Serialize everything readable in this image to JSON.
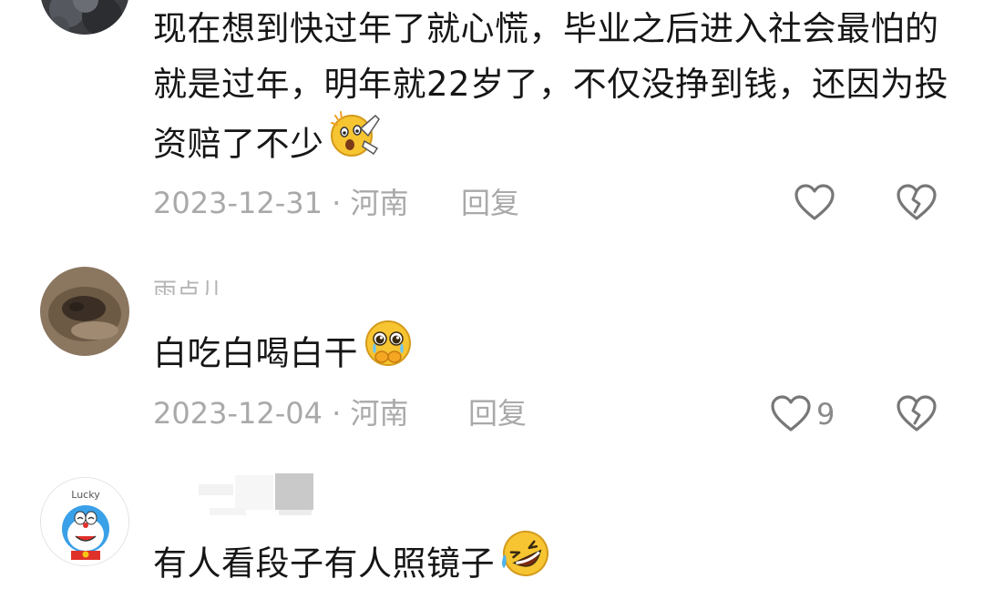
{
  "comments": [
    {
      "text": "现在想到快过年了就心慌，毕业之后进入社会最怕的就是过年，明年就22岁了，不仅没挣到钱，还因为投资赔了不少",
      "emoji": "shocked-face-icon",
      "date": "2023-12-31",
      "location": "河南",
      "reply_label": "回复",
      "likes": ""
    },
    {
      "username": "雨点儿",
      "text": "白吃白喝白干",
      "emoji": "crying-pleading-face-icon",
      "date": "2023-12-04",
      "location": "河南",
      "reply_label": "回复",
      "likes": "9"
    },
    {
      "avatar_text": "Lucky",
      "text": "有人看段子有人照镜子",
      "emoji": "rofl-face-icon"
    }
  ],
  "separator": " · ",
  "colors": {
    "text": "#161616",
    "meta": "#a9a9a9",
    "username": "#b4b4b4",
    "icon": "#777777"
  }
}
